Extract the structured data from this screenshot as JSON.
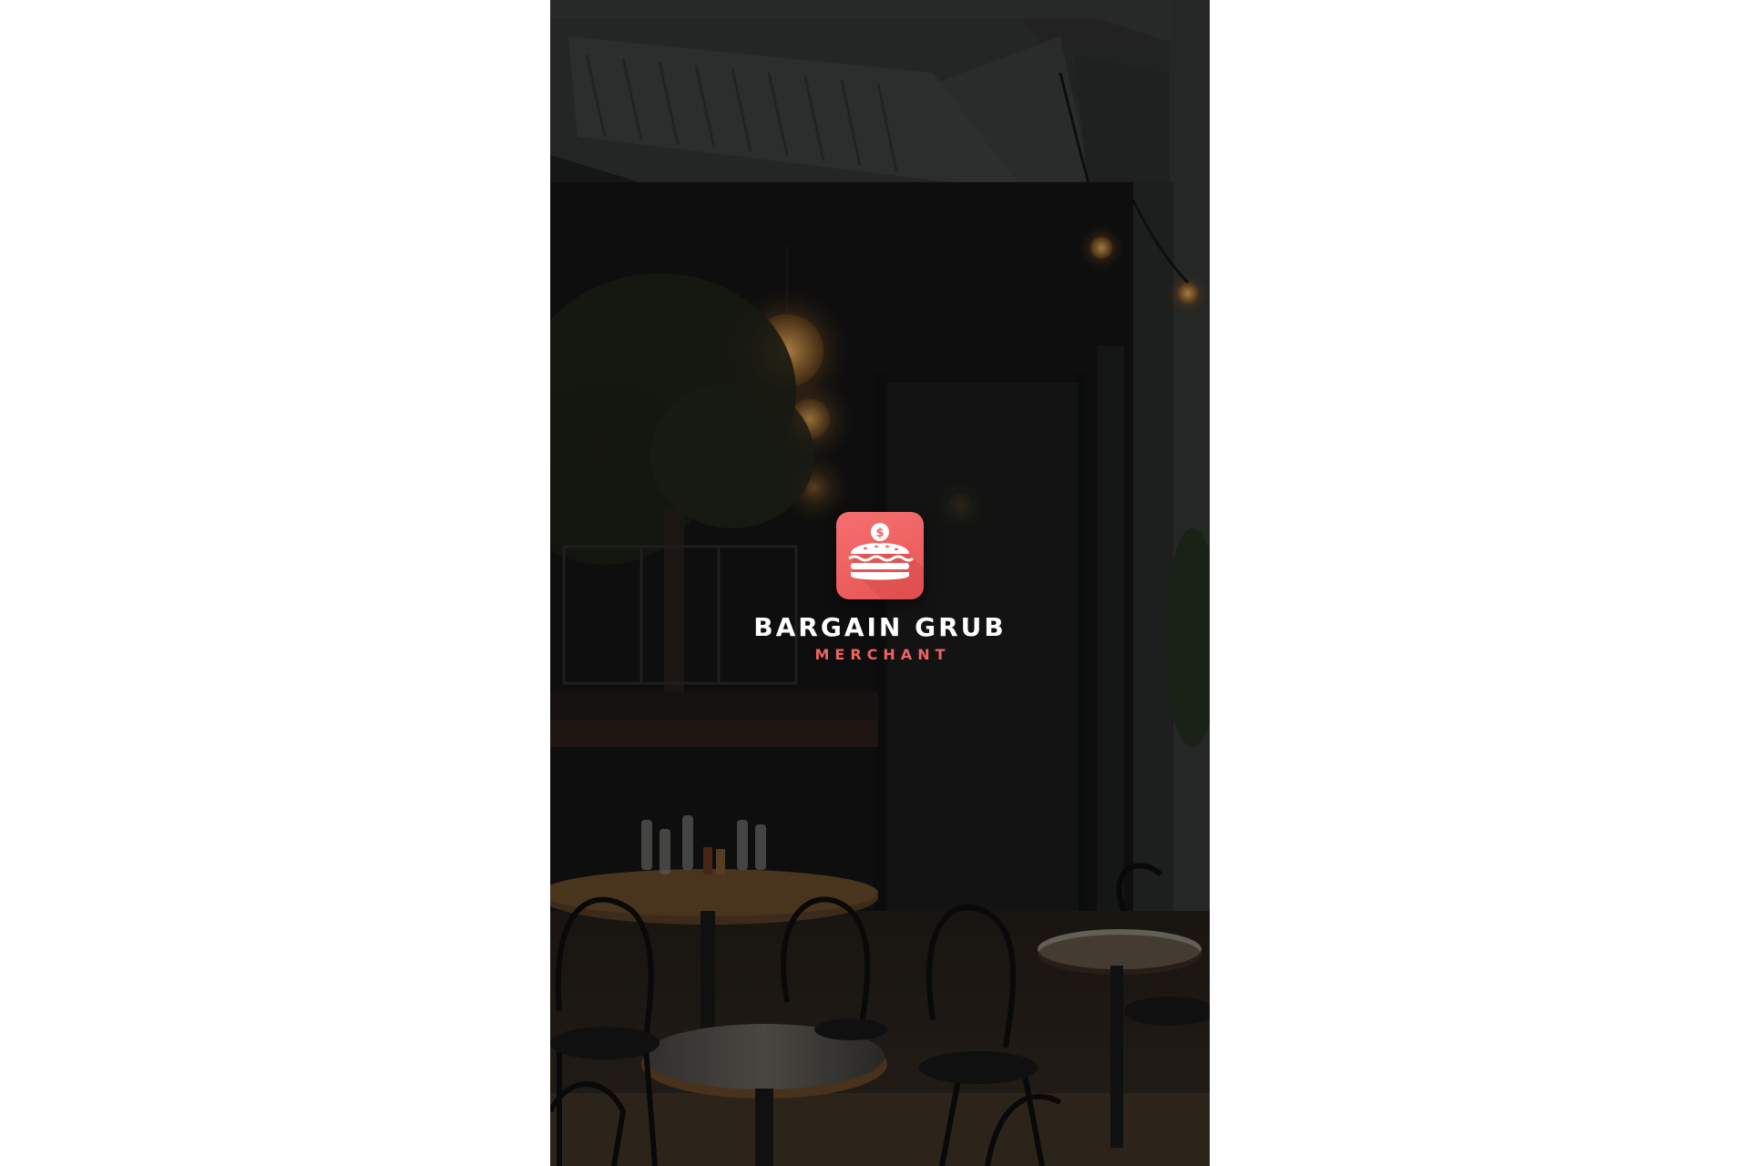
{
  "app": {
    "name": "BARGAIN GRUB",
    "subtitle": "MERCHANT"
  },
  "logo": {
    "icon": "burger-dollar-icon",
    "coin_symbol": "$"
  },
  "colors": {
    "accent": "#ef6363",
    "tile": "#f06565",
    "text_primary": "#ffffff",
    "page_background": "#ffffff"
  },
  "background": {
    "icon": "restaurant-terrace-photo"
  }
}
